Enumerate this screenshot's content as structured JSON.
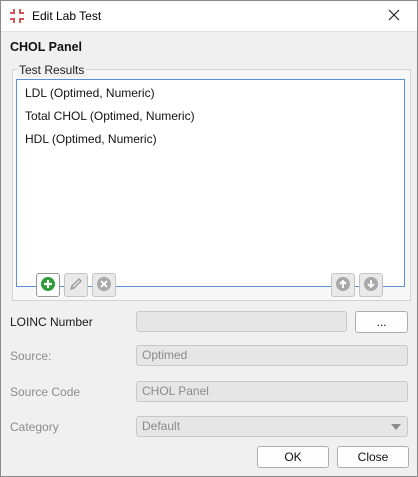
{
  "window": {
    "title": "Edit Lab Test"
  },
  "heading": "CHOL Panel",
  "test_results": {
    "legend": "Test Results",
    "items": [
      {
        "label": "LDL (Optimed, Numeric)"
      },
      {
        "label": "Total CHOL (Optimed, Numeric)"
      },
      {
        "label": "HDL (Optimed, Numeric)"
      }
    ]
  },
  "fields": {
    "loinc": {
      "label": "LOINC Number",
      "value": "",
      "browse_label": "..."
    },
    "source": {
      "label": "Source:",
      "value": "Optimed"
    },
    "source_code": {
      "label": "Source Code",
      "value": "CHOL Panel"
    },
    "category": {
      "label": "Category",
      "value": "Default"
    }
  },
  "buttons": {
    "ok": "OK",
    "close": "Close"
  },
  "colors": {
    "accent": "#5b8fd6",
    "add_green": "#2e9e3a",
    "app_icon_red": "#d9534f"
  },
  "icons": {
    "app": "medical-cross-icon",
    "close": "close-icon",
    "add": "add-icon",
    "edit": "pencil-icon",
    "remove": "remove-icon",
    "up": "arrow-up-icon",
    "down": "arrow-down-icon",
    "dropdown": "chevron-down-icon"
  }
}
